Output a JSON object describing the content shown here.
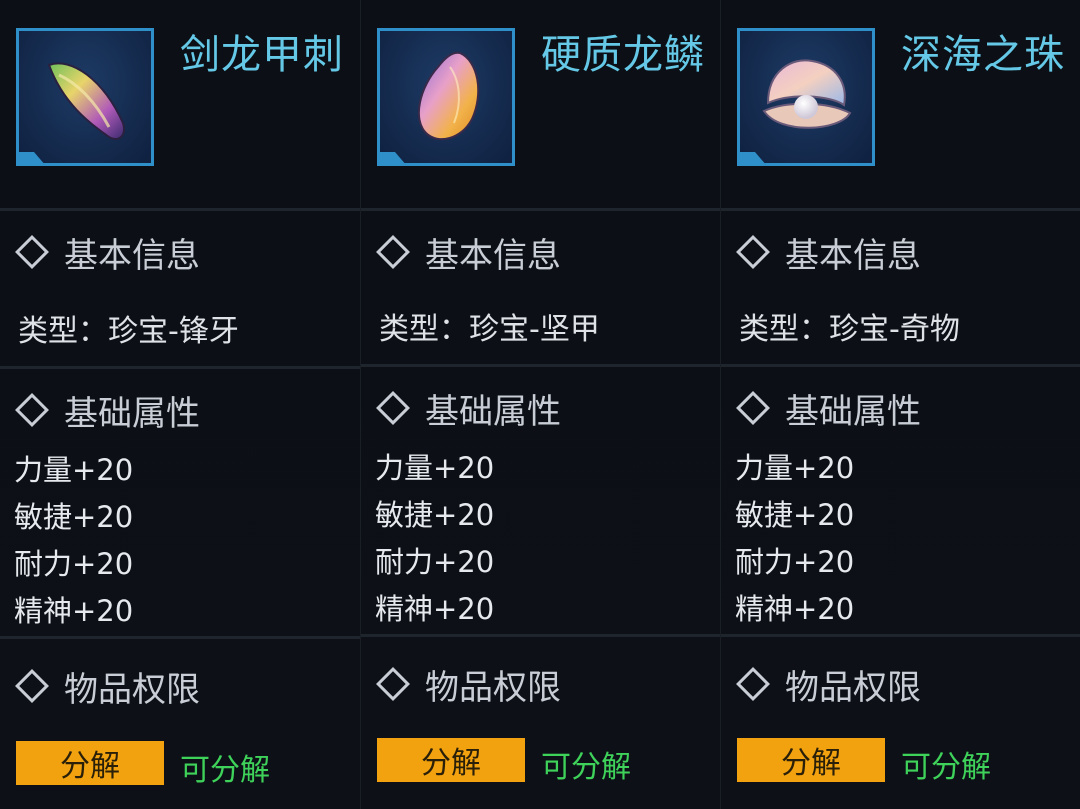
{
  "items": [
    {
      "name": "剑龙甲刺",
      "icon": "stegosaurus-spike-icon",
      "basic_info_label": "基本信息",
      "type_text": "类型：珍宝-锋牙",
      "attributes_label": "基础属性",
      "attributes": [
        "力量+20",
        "敏捷+20",
        "耐力+20",
        "精神+20"
      ],
      "permission_label": "物品权限",
      "button_label": "分解",
      "status": "可分解"
    },
    {
      "name": "硬质龙鳞",
      "icon": "hard-dragon-scale-icon",
      "basic_info_label": "基本信息",
      "type_text": "类型：珍宝-坚甲",
      "attributes_label": "基础属性",
      "attributes": [
        "力量+20",
        "敏捷+20",
        "耐力+20",
        "精神+20"
      ],
      "permission_label": "物品权限",
      "button_label": "分解",
      "status": "可分解"
    },
    {
      "name": "深海之珠",
      "icon": "deep-sea-pearl-icon",
      "basic_info_label": "基本信息",
      "type_text": "类型：珍宝-奇物",
      "attributes_label": "基础属性",
      "attributes": [
        "力量+20",
        "敏捷+20",
        "耐力+20",
        "精神+20"
      ],
      "permission_label": "物品权限",
      "button_label": "分解",
      "status": "可分解"
    }
  ],
  "colors": {
    "title": "#64c8e6",
    "frame": "#2f8fc8",
    "button": "#f2a20f",
    "status_green": "#3fd25a",
    "background": "#0a0d12"
  }
}
